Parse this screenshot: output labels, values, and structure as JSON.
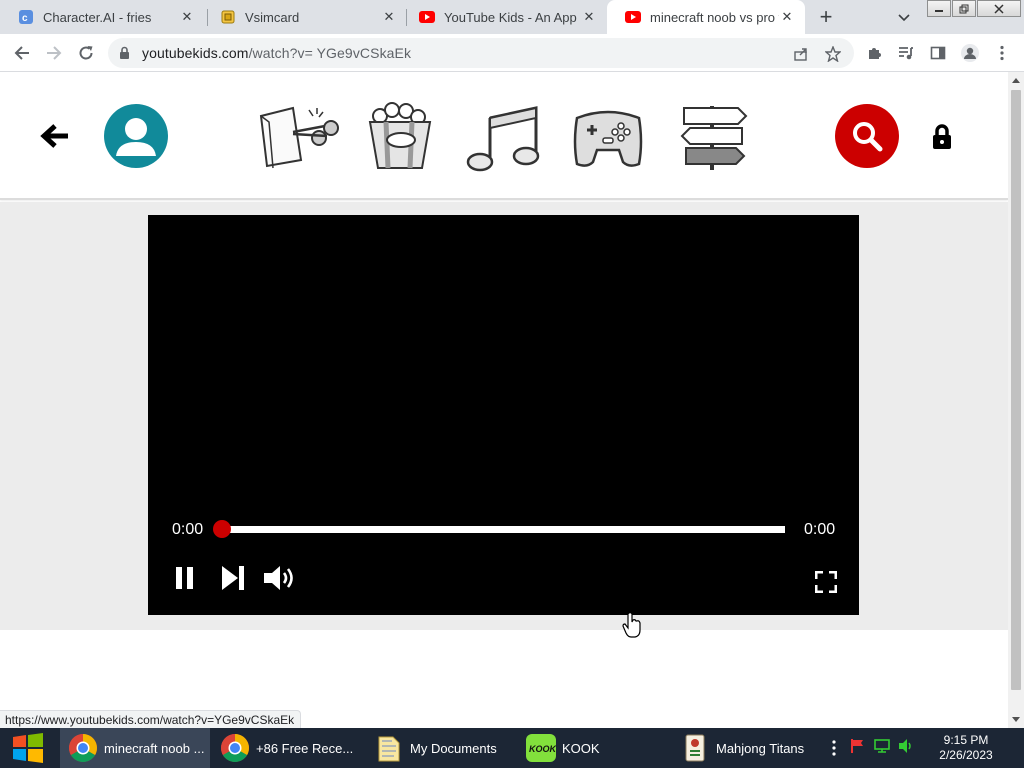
{
  "browser": {
    "tabs": [
      {
        "title": "Character.AI - fries",
        "active": false
      },
      {
        "title": "Vsimcard",
        "active": false
      },
      {
        "title": "YouTube Kids - An App",
        "active": false
      },
      {
        "title": "minecraft noob vs pro v",
        "active": true
      }
    ],
    "tab_close_glyph": "✕",
    "new_tab_glyph": "+",
    "address": {
      "host": "youtubekids.com",
      "path": "/watch?v= YGe9vCSkaEk"
    },
    "status_url": "https://www.youtubekids.com/watch?v=YGe9vCSkaEk"
  },
  "youtube_kids": {
    "categories": [
      {
        "name": "shows"
      },
      {
        "name": "recommended"
      },
      {
        "name": "music"
      },
      {
        "name": "gaming"
      },
      {
        "name": "explore"
      }
    ],
    "colors": {
      "profile": "#118a9a",
      "search": "#cc0000",
      "scrubber": "#cc0000"
    }
  },
  "player": {
    "current_time": "0:00",
    "duration": "0:00",
    "progress": 0
  },
  "taskbar": {
    "items": [
      {
        "label": "minecraft noob ...",
        "active": true
      },
      {
        "label": "+86 Free Rece...",
        "active": false
      },
      {
        "label": "My Documents",
        "active": false
      },
      {
        "label": "KOOK",
        "active": false
      },
      {
        "label": "Mahjong Titans",
        "active": false
      }
    ],
    "kook_logo_text": "KOOK",
    "clock": {
      "time": "9:15 PM",
      "date": "2/26/2023"
    }
  }
}
